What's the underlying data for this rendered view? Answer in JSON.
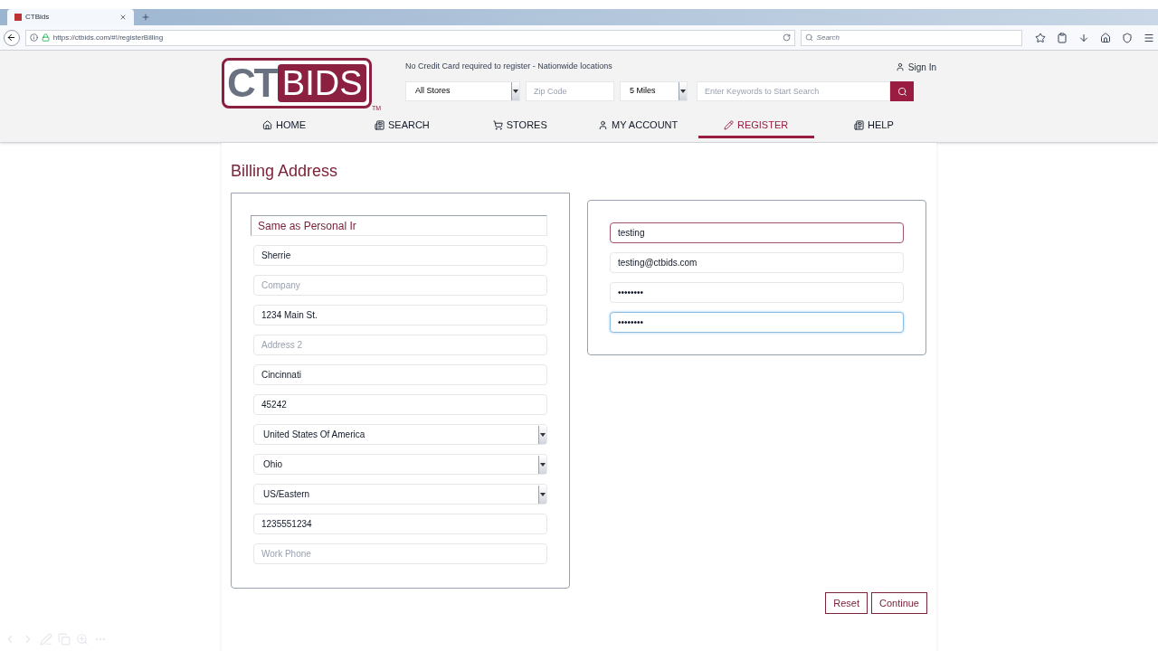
{
  "browser": {
    "tab_title": "CTBids",
    "url": "https://ctbids.com/#!/registerBilling",
    "search_placeholder": "Search"
  },
  "logo": {
    "left": "CT",
    "right": "BIDS",
    "mark": "TM"
  },
  "tagline": "No Credit Card required to register - Nationwide locations",
  "sign_in": "Sign In",
  "filters": {
    "store": "All Stores",
    "zip_placeholder": "Zip Code",
    "distance": "5 Miles",
    "keyword_placeholder": "Enter Keywords to Start Search"
  },
  "nav": [
    {
      "label": "HOME",
      "kind": "home",
      "selected": false
    },
    {
      "label": "SEARCH",
      "kind": "list",
      "selected": false
    },
    {
      "label": "STORES",
      "kind": "cart",
      "selected": false
    },
    {
      "label": "MY ACCOUNT",
      "kind": "user",
      "selected": false
    },
    {
      "label": "REGISTER",
      "kind": "pencil",
      "selected": true
    },
    {
      "label": "HELP",
      "kind": "list",
      "selected": false
    }
  ],
  "page_title": "Billing Address",
  "billing_fields": [
    {
      "kind": "link",
      "value": "Same as Personal Ir"
    },
    {
      "kind": "text",
      "value": "Sherrie"
    },
    {
      "kind": "text",
      "placeholder": "Company"
    },
    {
      "kind": "text",
      "value": "1234 Main St."
    },
    {
      "kind": "text",
      "placeholder": "Address 2"
    },
    {
      "kind": "text",
      "value": "Cincinnati"
    },
    {
      "kind": "text",
      "value": "45242"
    },
    {
      "kind": "select",
      "value": "United States Of America"
    },
    {
      "kind": "select",
      "value": "Ohio"
    },
    {
      "kind": "select",
      "value": "US/Eastern"
    },
    {
      "kind": "text",
      "value": "1235551234"
    },
    {
      "kind": "text",
      "placeholder": "Work Phone"
    }
  ],
  "account_fields": [
    {
      "value": "testing",
      "invalid": true,
      "focused": false
    },
    {
      "value": "testing@ctbids.com",
      "invalid": false,
      "focused": false
    },
    {
      "value": "••••••••",
      "invalid": false,
      "focused": false
    },
    {
      "value": "••••••••",
      "invalid": false,
      "focused": true
    }
  ],
  "buttons": [
    "Reset",
    "Continue"
  ]
}
